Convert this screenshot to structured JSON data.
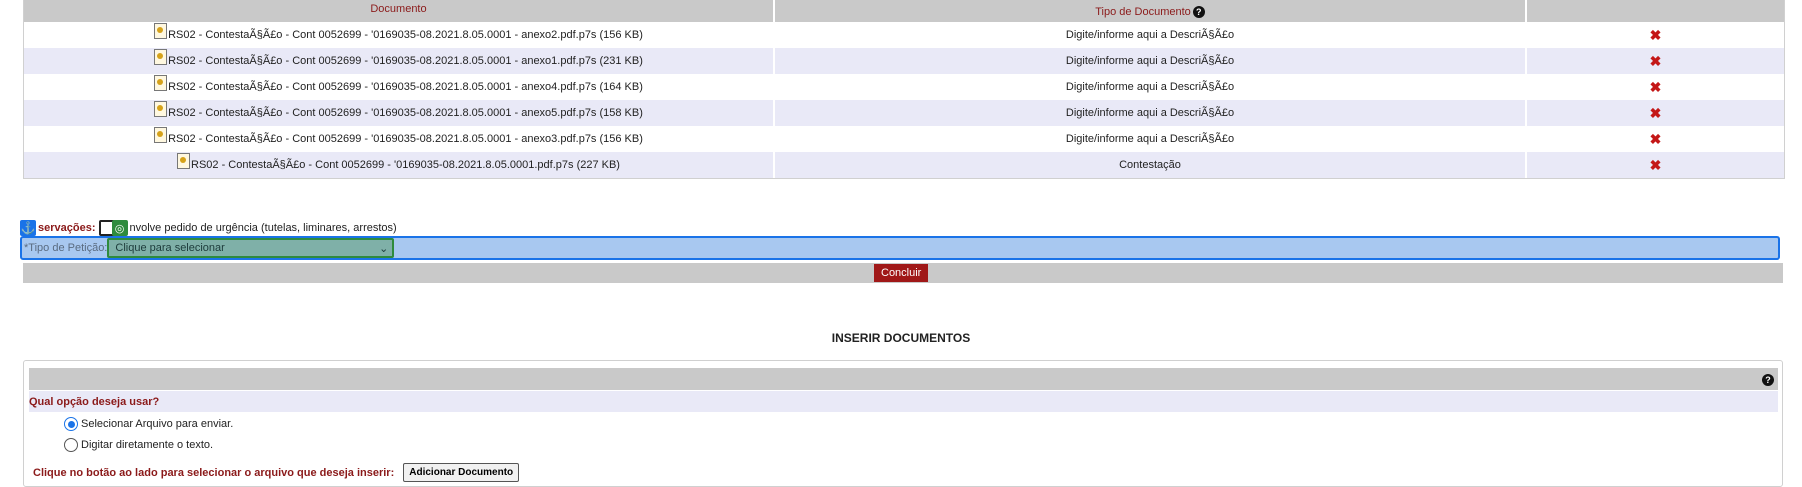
{
  "documents_table": {
    "headers": {
      "document": "Documento",
      "type": "Tipo de Documento"
    },
    "rows": [
      {
        "file": "RS02 - ContestaÃ§Ã£o - Cont 0052699 - '0169035-08.2021.8.05.0001 - anexo2.pdf.p7s (156 KB)",
        "type": "Digite/informe aqui a DescriÃ§Ã£o"
      },
      {
        "file": "RS02 - ContestaÃ§Ã£o - Cont 0052699 - '0169035-08.2021.8.05.0001 - anexo1.pdf.p7s (231 KB)",
        "type": "Digite/informe aqui a DescriÃ§Ã£o"
      },
      {
        "file": "RS02 - ContestaÃ§Ã£o - Cont 0052699 - '0169035-08.2021.8.05.0001 - anexo4.pdf.p7s (164 KB)",
        "type": "Digite/informe aqui a DescriÃ§Ã£o"
      },
      {
        "file": "RS02 - ContestaÃ§Ã£o - Cont 0052699 - '0169035-08.2021.8.05.0001 - anexo5.pdf.p7s (158 KB)",
        "type": "Digite/informe aqui a DescriÃ§Ã£o"
      },
      {
        "file": "RS02 - ContestaÃ§Ã£o - Cont 0052699 - '0169035-08.2021.8.05.0001 - anexo3.pdf.p7s (156 KB)",
        "type": "Digite/informe aqui a DescriÃ§Ã£o"
      },
      {
        "file": "RS02 - ContestaÃ§Ã£o - Cont 0052699 - '0169035-08.2021.8.05.0001.pdf.p7s (227 KB)",
        "type": "Contestação"
      }
    ]
  },
  "observations": {
    "label": "servações:",
    "urgency_label": "nvolve pedido de urgência (tutelas, liminares, arrestos)"
  },
  "petition": {
    "label": "*Tipo de Petição:",
    "select_value": "Clique para selecionar"
  },
  "conclude_label": "Concluir",
  "insert": {
    "title": "INSERIR DOCUMENTOS",
    "question": "Qual opção deseja usar?",
    "options": [
      "Selecionar Arquivo para enviar.",
      "Digitar diretamente o texto."
    ],
    "selected_option": "Selecionar Arquivo para enviar.",
    "file_prompt": "Clique no botão ao lado para selecionar o arquivo que deseja inserir:",
    "add_button": "Adicionar Documento"
  },
  "colors": {
    "accent": "#8b1a1a",
    "header_bg": "#c9c9c9",
    "row_alt": "#e9e9f7",
    "focus": "#1a73e8",
    "select_focus": "#2e8b3d"
  }
}
